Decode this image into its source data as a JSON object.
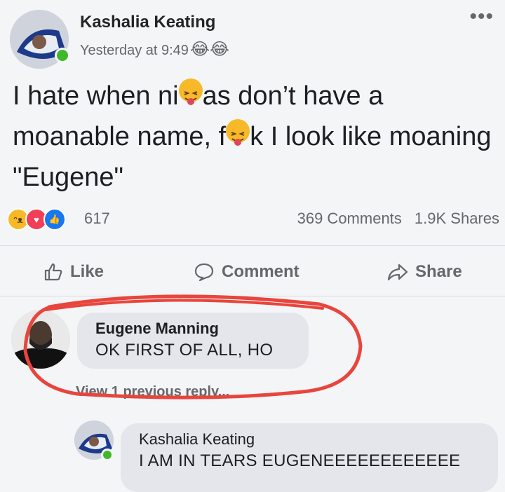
{
  "post": {
    "author": "Kashalia Keating",
    "timestamp": "Yesterday at 9:49",
    "text_part1": "I hate when ni",
    "text_part2": "as don’t have a moanable name, f",
    "text_part3": "k I look like moaning \"Eugene\"",
    "reaction_count": "617",
    "comments_count": "369 Comments",
    "shares_count": "1.9K Shares",
    "timestamp_emoji": "😂😂"
  },
  "actions": {
    "like": "Like",
    "comment": "Comment",
    "share": "Share"
  },
  "comments": [
    {
      "author": "Eugene Manning",
      "text": "OK FIRST OF ALL, HO"
    },
    {
      "author": "Kashalia Keating",
      "text": "I AM IN TEARS EUGENEEEEEEEEEEEE"
    }
  ],
  "view_previous": "View 1 previous reply...",
  "colors": {
    "highlight_circle": "#e8453c",
    "like_blue": "#1877f2",
    "love_red": "#f33e58",
    "haha_yellow": "#f7b928"
  }
}
